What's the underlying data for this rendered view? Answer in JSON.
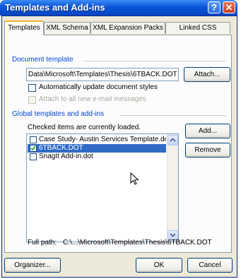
{
  "window": {
    "title": "Templates and Add-ins",
    "help_glyph": "?",
    "close_glyph": "✕"
  },
  "tabs": [
    {
      "label": "Templates",
      "active": true
    },
    {
      "label": "XML Schema",
      "active": false
    },
    {
      "label": "XML Expansion Packs",
      "active": false
    },
    {
      "label": "Linked CSS",
      "active": false
    }
  ],
  "document_template": {
    "group_label": "Document template",
    "path_value": "Data\\Microsoft\\Templates\\Thesis\\6TBACK.DOT",
    "attach_label": "Attach...",
    "auto_update_label": "Automatically update document styles",
    "auto_update_checked": false,
    "attach_email_label": "Attach to all new e-mail messages",
    "attach_email_checked": false
  },
  "global_templates": {
    "group_label": "Global templates and add-ins",
    "hint": "Checked items are currently loaded.",
    "items": [
      {
        "label": "Case Study- Austin Services Template.dot",
        "checked": false,
        "selected": false
      },
      {
        "label": "6TBACK.DOT",
        "checked": true,
        "selected": true
      },
      {
        "label": "SnagIt Add-in.dot",
        "checked": false,
        "selected": false
      }
    ],
    "add_label": "Add...",
    "remove_label": "Remove",
    "full_path_label": "Full path:",
    "full_path_value": "C:\\...\\Microsoft\\Templates\\Thesis\\6TBACK.DOT"
  },
  "footer": {
    "organizer_label": "Organizer...",
    "ok_label": "OK",
    "cancel_label": "Cancel"
  },
  "colors": {
    "title_bar": "#0a55d8",
    "group_label": "#0046d5",
    "selection": "#316ac5",
    "tab_accent": "#f8b342"
  }
}
